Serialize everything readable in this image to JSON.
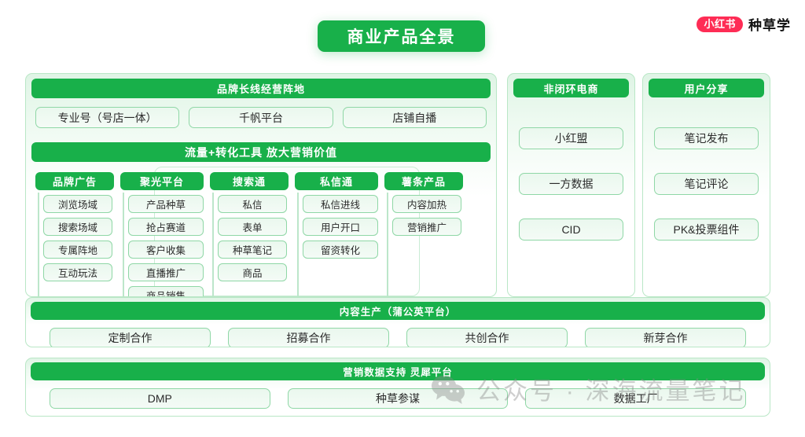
{
  "header": {
    "title": "商业产品全景",
    "brand_pill": "小红书",
    "brand_name": "种草学"
  },
  "sections": {
    "brand_long_term": {
      "bar": "品牌长线经营阵地",
      "items": [
        "专业号（号店一体）",
        "千帆平台",
        "店铺自播"
      ],
      "traffic_bar": "流量+转化工具  放大营销价值",
      "columns": [
        {
          "header": "品牌广告",
          "items": [
            "浏览场域",
            "搜索场域",
            "专属阵地",
            "互动玩法"
          ]
        },
        {
          "header": "聚光平台",
          "items": [
            "产品种草",
            "抢占赛道",
            "客户收集",
            "直播推广",
            "商品销售"
          ]
        },
        {
          "header": "搜索通",
          "items": [
            "私信",
            "表单",
            "种草笔记",
            "商品"
          ]
        },
        {
          "header": "私信通",
          "items": [
            "私信进线",
            "用户开口",
            "留资转化"
          ]
        },
        {
          "header": "薯条产品",
          "items": [
            "内容加热",
            "营销推广"
          ]
        }
      ]
    },
    "non_closed_loop": {
      "bar": "非闭环电商",
      "items": [
        "小红盟",
        "一方数据",
        "CID"
      ]
    },
    "user_share": {
      "bar": "用户分享",
      "items": [
        "笔记发布",
        "笔记评论",
        "PK&投票组件"
      ]
    },
    "content_production": {
      "bar": "内容生产（蒲公英平台）",
      "items": [
        "定制合作",
        "招募合作",
        "共创合作",
        "新芽合作"
      ]
    },
    "marketing_data": {
      "bar": "营销数据支持 灵犀平台",
      "items": [
        "DMP",
        "种草参谋",
        "数据工厂"
      ]
    }
  },
  "watermark": {
    "text": "公众号 · 深海流量笔记",
    "icon": "wechat-icon"
  },
  "colors": {
    "green": "#18b04a",
    "light_green": "#eaf8ee",
    "border_green": "#8fd7a6",
    "brand_red": "#fe2c55"
  }
}
